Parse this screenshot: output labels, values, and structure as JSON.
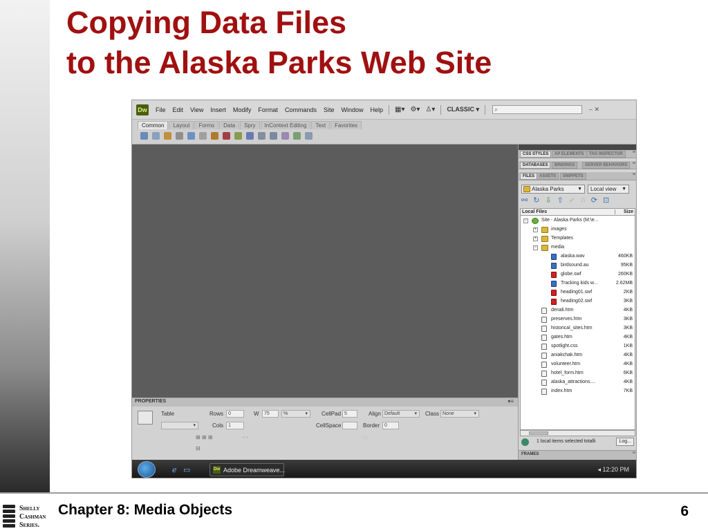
{
  "slide": {
    "title_line1": "Copying Data Files",
    "title_line2": "to the Alaska Parks Web Site",
    "chapter": "Chapter 8: Media Objects",
    "page_number": "6",
    "logo_lines": [
      "Shelly",
      "Cashman",
      "Series."
    ]
  },
  "app": {
    "logo": "Dw",
    "menu": [
      "File",
      "Edit",
      "View",
      "Insert",
      "Modify",
      "Format",
      "Commands",
      "Site",
      "Window",
      "Help"
    ],
    "workspace": "CLASSIC",
    "window_controls": "– ✕"
  },
  "insert_tabs": [
    "Common",
    "Layout",
    "Forms",
    "Data",
    "Spry",
    "InContext Editing",
    "Text",
    "Favorites"
  ],
  "properties": {
    "title": "PROPERTIES",
    "table_label": "Table",
    "rows_label": "Rows",
    "rows_value": "0",
    "cols_label": "Cols",
    "cols_value": "1",
    "w_label": "W",
    "w_value": "75",
    "w_unit": "%",
    "cellpad_label": "CellPad",
    "cellpad_value": "5",
    "cellspace_label": "CellSpace",
    "align_label": "Align",
    "align_value": "Default",
    "class_label": "Class",
    "class_value": "None",
    "border_label": "Border",
    "border_value": "0"
  },
  "panels": {
    "row1_tabs": [
      "CSS STYLES",
      "AP ELEMENTS",
      "TAG INSPECTOR"
    ],
    "row2_tabs": [
      "DATABASES",
      "BINDINGS",
      "SERVER BEHAVIORS"
    ],
    "row3_tabs": [
      "FILES",
      "ASSETS",
      "SNIPPETS"
    ],
    "site_select": "Alaska Parks",
    "view_select": "Local view",
    "header_name": "Local Files",
    "header_size": "Size",
    "status_text": "1 local items selected totalli",
    "log_button": "Log...",
    "frames_label": "FRAMES"
  },
  "files": [
    {
      "name": "Site - Alaska Parks (M:\\e...",
      "size": "",
      "kind": "site",
      "indent": 0,
      "exp": "-"
    },
    {
      "name": "images",
      "size": "",
      "kind": "folder",
      "indent": 1,
      "exp": "+"
    },
    {
      "name": "Templates",
      "size": "",
      "kind": "folder",
      "indent": 1,
      "exp": "+"
    },
    {
      "name": "media",
      "size": "",
      "kind": "folder",
      "indent": 1,
      "exp": "-"
    },
    {
      "name": "alaska.wav",
      "size": "460KB",
      "kind": "media",
      "indent": 2,
      "exp": ""
    },
    {
      "name": "birdsound.au",
      "size": "95KB",
      "kind": "media",
      "indent": 2,
      "exp": ""
    },
    {
      "name": "globe.swf",
      "size": "260KB",
      "kind": "swf",
      "indent": 2,
      "exp": ""
    },
    {
      "name": "Tracking kids w...",
      "size": "2.62MB",
      "kind": "media",
      "indent": 2,
      "exp": ""
    },
    {
      "name": "heading01.swf",
      "size": "2KB",
      "kind": "swf",
      "indent": 2,
      "exp": ""
    },
    {
      "name": "heading02.swf",
      "size": "3KB",
      "kind": "swf",
      "indent": 2,
      "exp": ""
    },
    {
      "name": "denali.htm",
      "size": "4KB",
      "kind": "page",
      "indent": 1,
      "exp": ""
    },
    {
      "name": "preserves.htm",
      "size": "3KB",
      "kind": "page",
      "indent": 1,
      "exp": ""
    },
    {
      "name": "historical_sites.htm",
      "size": "3KB",
      "kind": "page",
      "indent": 1,
      "exp": ""
    },
    {
      "name": "gates.htm",
      "size": "4KB",
      "kind": "page",
      "indent": 1,
      "exp": ""
    },
    {
      "name": "spotlight.css",
      "size": "1KB",
      "kind": "page",
      "indent": 1,
      "exp": ""
    },
    {
      "name": "aniakchak.htm",
      "size": "4KB",
      "kind": "page",
      "indent": 1,
      "exp": ""
    },
    {
      "name": "volunteer.htm",
      "size": "4KB",
      "kind": "page",
      "indent": 1,
      "exp": ""
    },
    {
      "name": "hotel_form.htm",
      "size": "6KB",
      "kind": "page",
      "indent": 1,
      "exp": ""
    },
    {
      "name": "alaska_attractions....",
      "size": "4KB",
      "kind": "page",
      "indent": 1,
      "exp": ""
    },
    {
      "name": "index.htm",
      "size": "7KB",
      "kind": "page",
      "indent": 1,
      "exp": ""
    }
  ],
  "taskbar": {
    "task_label": "Adobe Dreamweave...",
    "task_icon": "Dw",
    "clock": "12:20 PM"
  }
}
